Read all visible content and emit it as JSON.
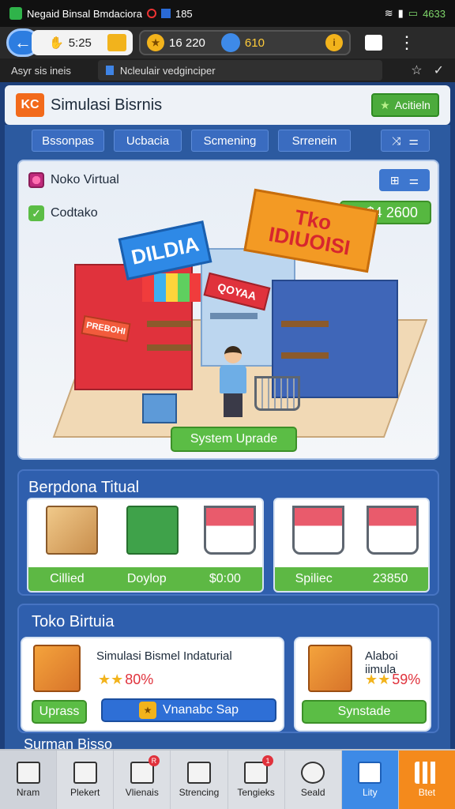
{
  "status_bar": {
    "app_title": "Negaid Binsal Bmdaciora",
    "left_value": "185",
    "right_value": "4633"
  },
  "browser": {
    "back_icon": "arrow-left-icon",
    "time": "5:25",
    "stat_value": "16 220",
    "coins_value": "610"
  },
  "url_row": {
    "left_text": "Asyr sis ineis",
    "tab_title": "Ncleulair vedginciper"
  },
  "header": {
    "title": "Simulasi Bisrnis",
    "logo_text": "KC",
    "action_label": "Acitieln"
  },
  "tabs": [
    "Bssonpas",
    "Ucbacia",
    "Scmening",
    "Srrenein"
  ],
  "scene": {
    "option1": "Noko Virtual",
    "option2": "Codtako",
    "money": "$4 2600",
    "sign_blue": "DILDIA",
    "sign_orange_line1": "Tko",
    "sign_orange_line2": "IDIUOISI",
    "sign_red": "QOYAA",
    "sign_small": "PREBOHI",
    "upgrade_label": "System Uprade"
  },
  "panel1": {
    "title": "Berpdona Titual",
    "card1_labels": [
      "Cillied",
      "Doylop",
      "$0:00"
    ],
    "card2_labels": [
      "Spiliec",
      "23850"
    ]
  },
  "panel2": {
    "title": "Toko Birtuia",
    "card1": {
      "name": "Simulasi Bismel Indaturial",
      "rating": "80%",
      "btn1": "Uprass",
      "btn2": "Vnanabc Sap"
    },
    "card2": {
      "name": "Alaboi iimula",
      "rating": "59%",
      "btn": "Synstade"
    }
  },
  "next_heading": "Surman Bisso",
  "bottom_nav": [
    {
      "label": "Nram",
      "icon": "home-icon"
    },
    {
      "label": "Plekert",
      "icon": "store-icon"
    },
    {
      "label": "Vlienais",
      "icon": "grid-icon",
      "badge": "R"
    },
    {
      "label": "Strencing",
      "icon": "document-icon"
    },
    {
      "label": "Tengieks",
      "icon": "cart-icon",
      "badge": "1"
    },
    {
      "label": "Seald",
      "icon": "search-icon"
    },
    {
      "label": "Lity",
      "icon": "cube-icon"
    },
    {
      "label": "Btet",
      "icon": "menu-grid-icon"
    }
  ]
}
